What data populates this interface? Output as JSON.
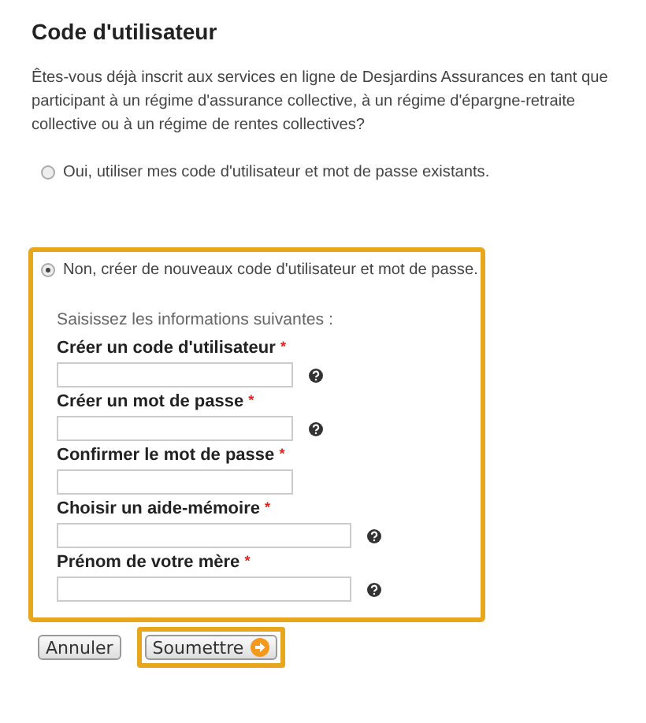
{
  "title": "Code d'utilisateur",
  "intro": "Êtes-vous déjà inscrit aux services en ligne de Desjardins Assurances en tant que participant à un régime d'assurance collective, à un régime d'épargne-retraite collective ou à un régime de rentes collectives?",
  "options": [
    {
      "label": "Oui, utiliser mes code d'utilisateur et mot de passe existants.",
      "selected": false
    },
    {
      "label": "Non, créer de nouveaux code d'utilisateur et mot de passe.",
      "selected": true
    }
  ],
  "form": {
    "highlighted": true,
    "instructions": "Saisissez les informations suivantes :",
    "fields": [
      {
        "label": "Créer un code d'utilisateur",
        "mark": "*",
        "kind": "short",
        "help": true
      },
      {
        "label": "Créer un mot de passe",
        "mark": "*",
        "kind": "short",
        "help": true
      },
      {
        "label": "Confirmer le mot de passe",
        "mark": "*",
        "kind": "short",
        "help": false
      },
      {
        "label": "Choisir un aide-mémoire",
        "mark": "*",
        "kind": "long",
        "help": true
      },
      {
        "label": "Prénom de votre mère",
        "mark": "*",
        "kind": "long",
        "help": true
      }
    ]
  },
  "buttons": [
    {
      "label": "Annuler",
      "kind": "plain",
      "highlighted": false
    },
    {
      "label": "Soumettre",
      "kind": "submit",
      "highlighted": true
    }
  ]
}
